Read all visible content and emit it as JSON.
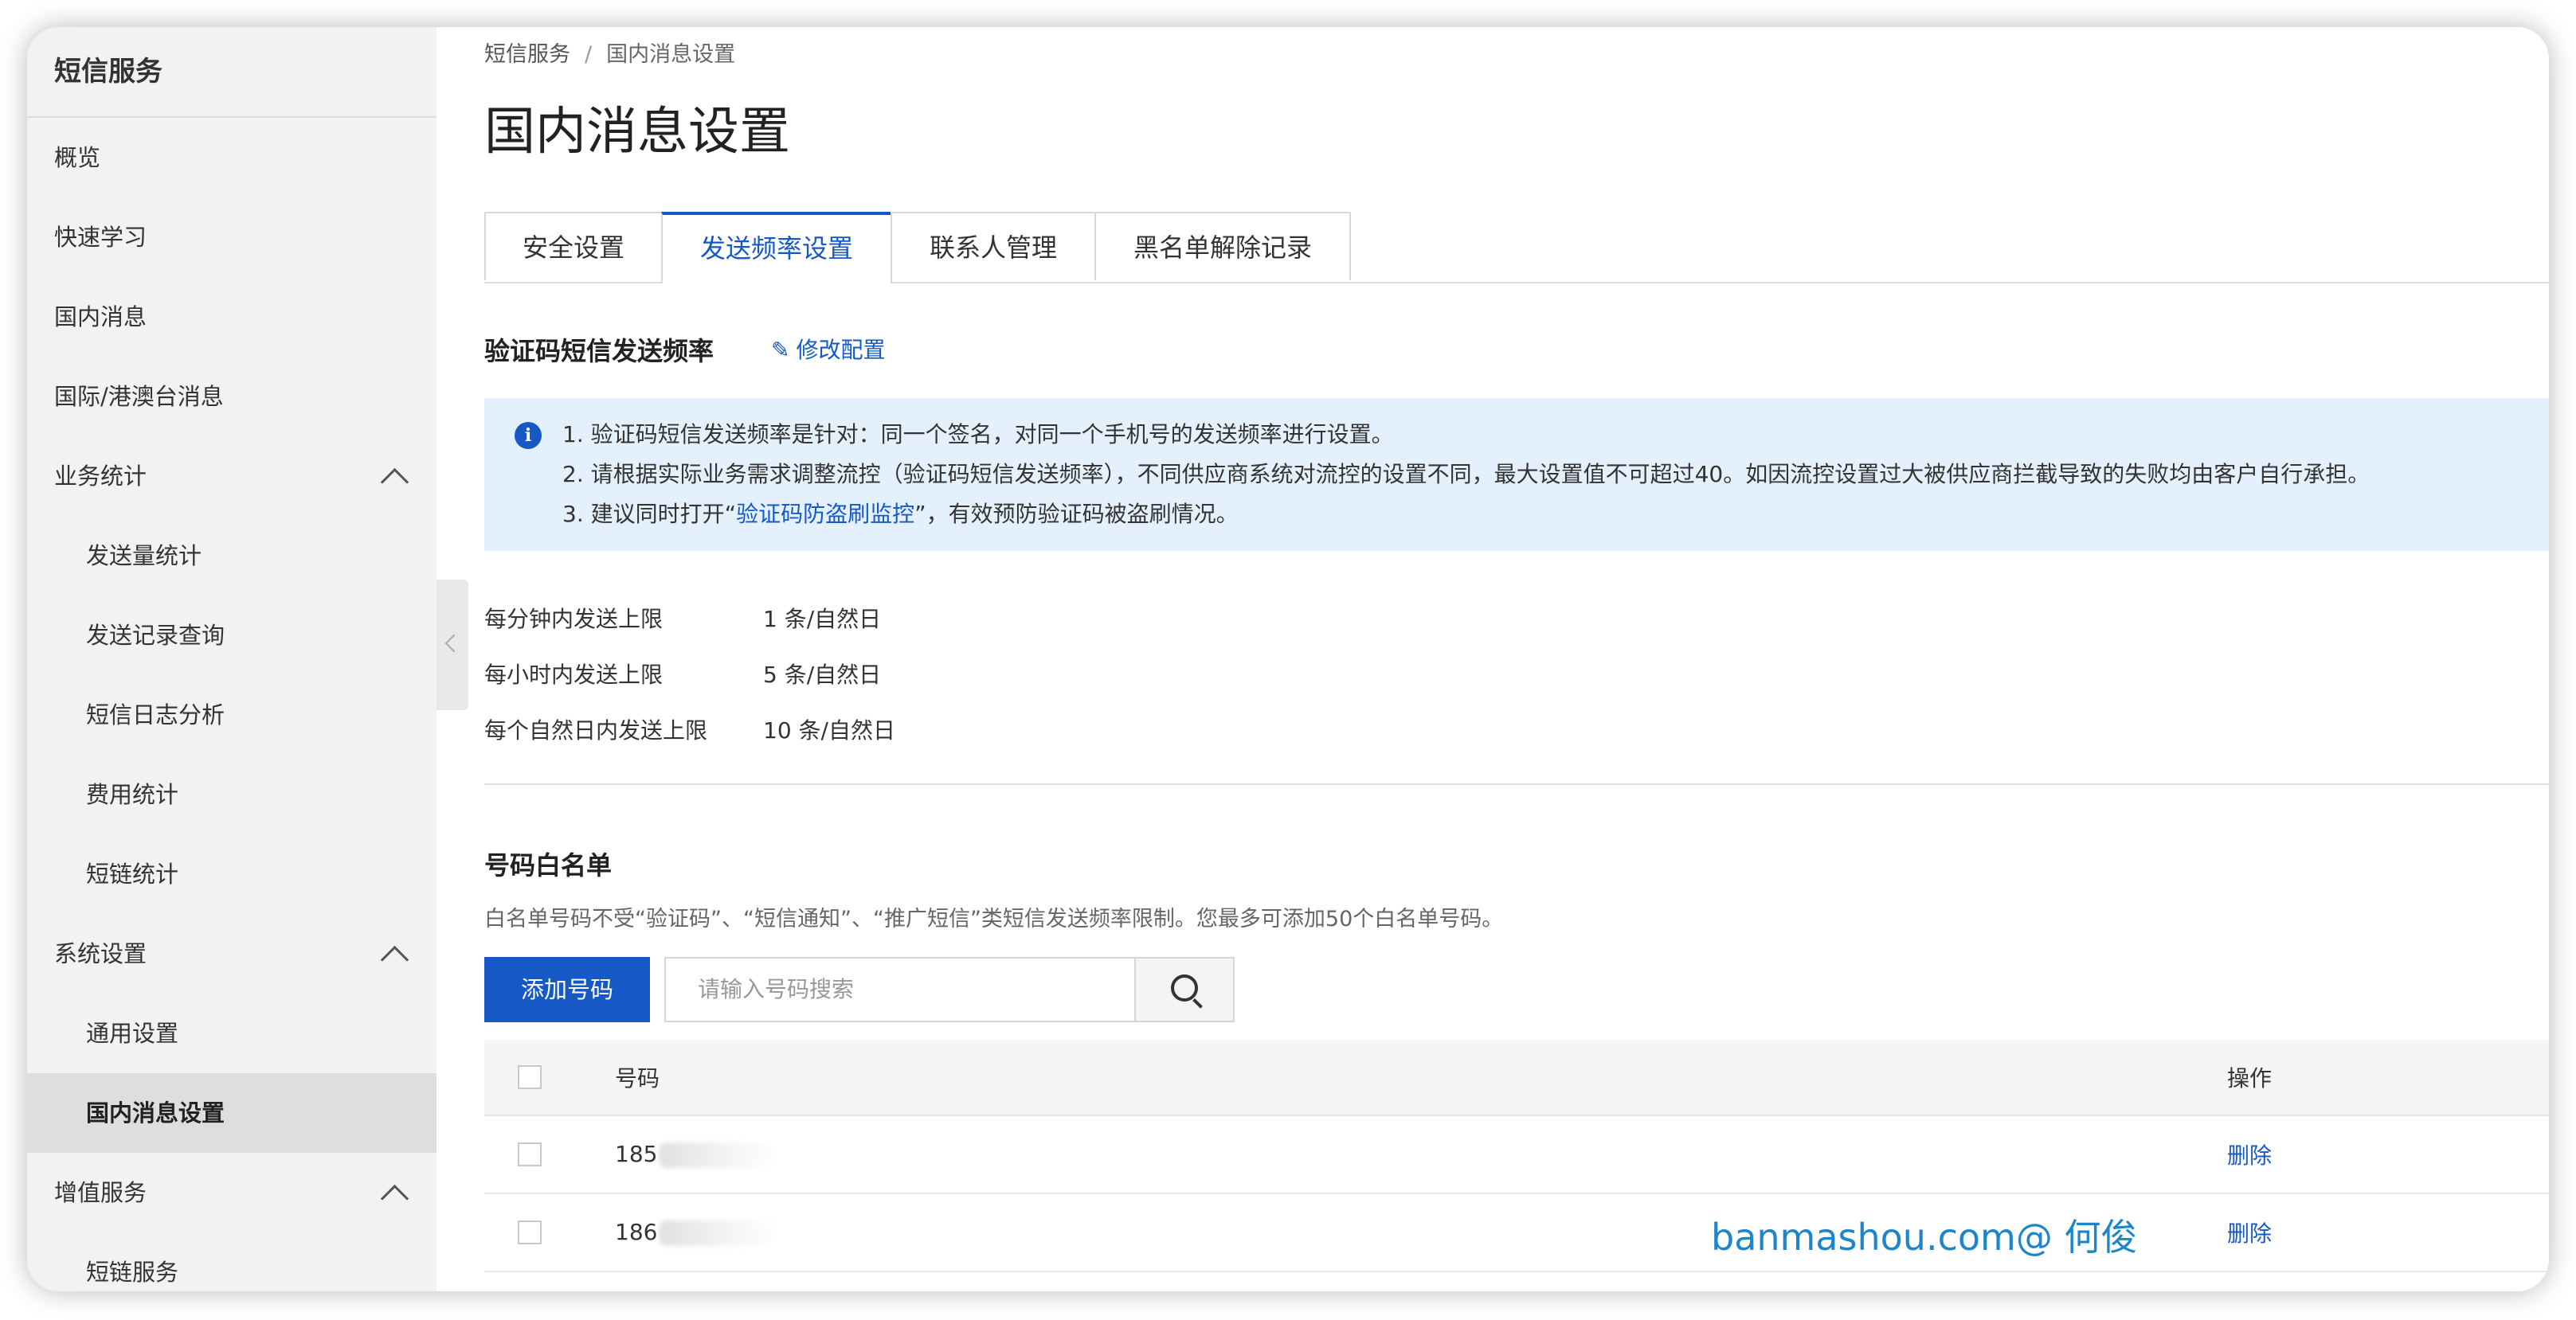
{
  "sidebar": {
    "title": "短信服务",
    "items": [
      {
        "label": "概览",
        "type": "item"
      },
      {
        "label": "快速学习",
        "type": "item"
      },
      {
        "label": "国内消息",
        "type": "item"
      },
      {
        "label": "国际/港澳台消息",
        "type": "item"
      },
      {
        "label": "业务统计",
        "type": "group"
      },
      {
        "label": "发送量统计",
        "type": "sub"
      },
      {
        "label": "发送记录查询",
        "type": "sub"
      },
      {
        "label": "短信日志分析",
        "type": "sub"
      },
      {
        "label": "费用统计",
        "type": "sub"
      },
      {
        "label": "短链统计",
        "type": "sub"
      },
      {
        "label": "系统设置",
        "type": "group"
      },
      {
        "label": "通用设置",
        "type": "sub"
      },
      {
        "label": "国内消息设置",
        "type": "sub",
        "active": true
      },
      {
        "label": "增值服务",
        "type": "group"
      },
      {
        "label": "短链服务",
        "type": "sub"
      }
    ]
  },
  "breadcrumb": {
    "root": "短信服务",
    "sep": "/",
    "current": "国内消息设置"
  },
  "page_title": "国内消息设置",
  "tabs": [
    {
      "label": "安全设置"
    },
    {
      "label": "发送频率设置",
      "active": true
    },
    {
      "label": "联系人管理"
    },
    {
      "label": "黑名单解除记录"
    }
  ],
  "frequency": {
    "title": "验证码短信发送频率",
    "edit_label": "修改配置",
    "notice": {
      "line1": "1. 验证码短信发送频率是针对：同一个签名，对同一个手机号的发送频率进行设置。",
      "line2": "2. 请根据实际业务需求调整流控（验证码短信发送频率），不同供应商系统对流控的设置不同，最大设置值不可超过40。如因流控设置过大被供应商拦截导致的失败均由客户自行承担。",
      "line3_pre": "3. 建议同时打开“",
      "line3_link": "验证码防盗刷监控",
      "line3_post": "”，有效预防验证码被盗刷情况。"
    },
    "limits": [
      {
        "key": "每分钟内发送上限",
        "value": "1 条/自然日"
      },
      {
        "key": "每小时内发送上限",
        "value": "5 条/自然日"
      },
      {
        "key": "每个自然日内发送上限",
        "value": "10 条/自然日"
      }
    ]
  },
  "whitelist": {
    "title": "号码白名单",
    "desc": "白名单号码不受“验证码”、“短信通知”、“推广短信”类短信发送频率限制。您最多可添加50个白名单号码。",
    "add_label": "添加号码",
    "search_placeholder": "请输入号码搜索",
    "columns": {
      "number": "号码",
      "op": "操作"
    },
    "rows": [
      {
        "number": "185",
        "op": "删除"
      },
      {
        "number": "186",
        "op": "删除"
      }
    ]
  },
  "watermark": "banmashou.com@ 何俊",
  "colors": {
    "accent": "#1558c6",
    "notice_bg": "#e4f1fd",
    "sidebar_bg": "#f2f2f2",
    "watermark": "#1e86c8"
  }
}
